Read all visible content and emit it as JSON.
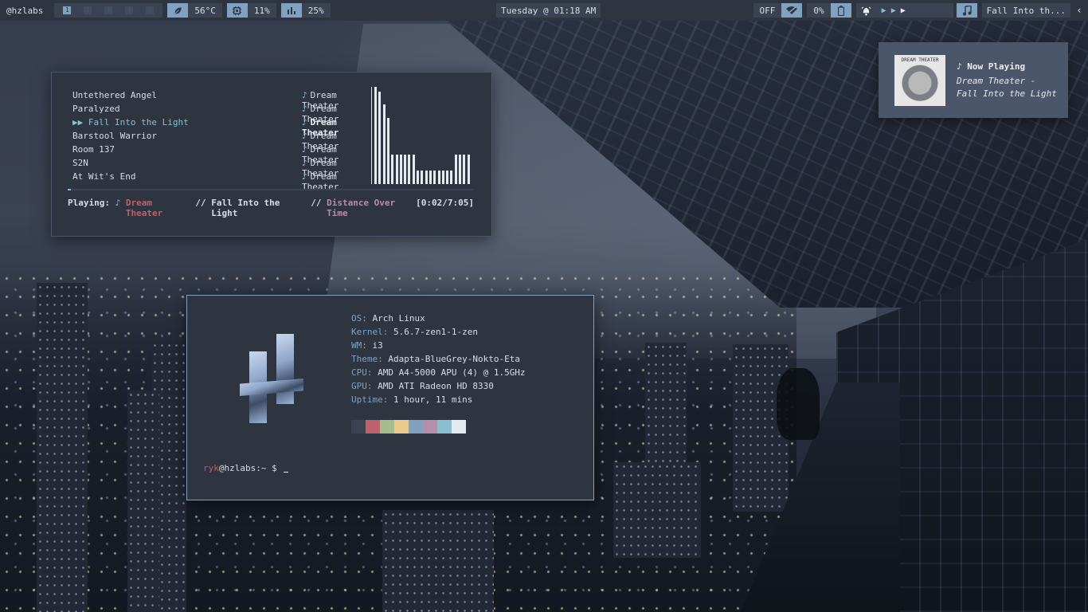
{
  "topbar": {
    "user": "@hzlabs",
    "workspaces": [
      "1",
      "2",
      "3",
      "4",
      "5"
    ],
    "temp": "56°C",
    "cpu": "11%",
    "mem": "25%",
    "clock": "Tuesday @ 01:18 AM",
    "wifi_state": "OFF",
    "battery": "0%",
    "now_playing_tab": "Fall Into th...",
    "icons": {
      "temp": "leaf-icon",
      "cpu": "cpu-icon",
      "mem": "bar-chart-icon",
      "wifi": "wifi-off-icon",
      "battery": "battery-icon",
      "bell": "bell-icon",
      "music": "music-note-icon",
      "chevron": "chevron-left-icon"
    }
  },
  "player": {
    "playlist": [
      {
        "title": "Untethered Angel",
        "artist": "Dream Theater"
      },
      {
        "title": "Paralyzed",
        "artist": "Dream Theater"
      },
      {
        "title": "Fall Into the Light",
        "artist": "Dream Theater",
        "current": true
      },
      {
        "title": "Barstool Warrior",
        "artist": "Dream Theater"
      },
      {
        "title": "Room 137",
        "artist": "Dream Theater"
      },
      {
        "title": "S2N",
        "artist": "Dream Theater"
      },
      {
        "title": "At Wit's End",
        "artist": "Dream Theater"
      }
    ],
    "current_marker": "▶▶",
    "status_label": "Playing:",
    "status_artist": "Dream Theater",
    "status_sep": "//",
    "status_song": "Fall Into the Light",
    "status_album": "Distance Over Time",
    "time": "[0:02/7:05]",
    "progress_fraction": 0.0047,
    "visualizer_levels": [
      1.0,
      0.95,
      0.82,
      0.68,
      0.3,
      0.3,
      0.3,
      0.3,
      0.3,
      0.3,
      0.14,
      0.14,
      0.14,
      0.14,
      0.14,
      0.14,
      0.14,
      0.14,
      0.14,
      0.3,
      0.3,
      0.3,
      0.3
    ]
  },
  "neofetch": {
    "rows": [
      {
        "key": "OS:",
        "value": "Arch Linux"
      },
      {
        "key": "Kernel:",
        "value": "5.6.7-zen1-1-zen"
      },
      {
        "key": "WM:",
        "value": "i3"
      },
      {
        "key": "Theme:",
        "value": "Adapta-BlueGrey-Nokto-Eta"
      },
      {
        "key": "CPU:",
        "value": "AMD A4-5000 APU (4) @ 1.5GHz"
      },
      {
        "key": "GPU:",
        "value": "AMD ATI Radeon HD 8330"
      },
      {
        "key": "Uptime:",
        "value": "1 hour, 11 mins"
      }
    ],
    "palette": [
      "#3b4252",
      "#bf616a",
      "#a3be8c",
      "#ebcb8b",
      "#81a1c1",
      "#b48ead",
      "#88c0d0",
      "#e5e9f0"
    ],
    "prompt_user": "ryk",
    "prompt_rest": "@hzlabs:~ $"
  },
  "notification": {
    "title": "Now Playing",
    "line1": "Dream Theater -",
    "line2": "Fall Into the Light",
    "album_brand": "DREAM THEATER"
  }
}
